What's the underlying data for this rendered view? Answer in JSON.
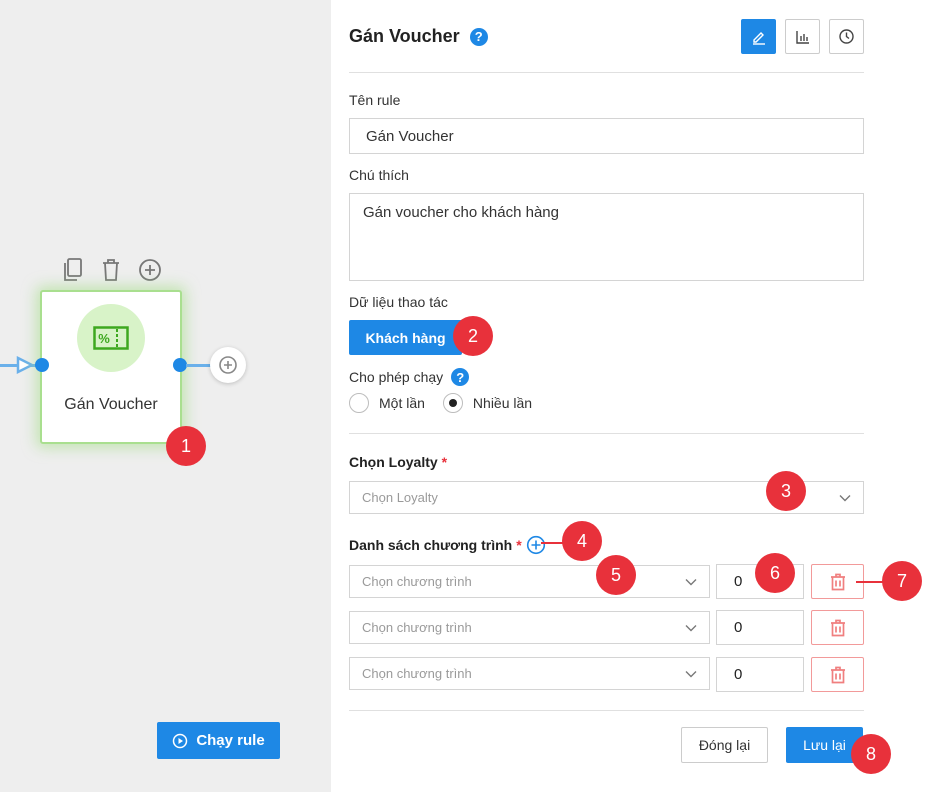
{
  "canvas": {
    "node_label": "Gán Voucher",
    "node_icon": "voucher-percent-icon",
    "tools": [
      "copy-icon",
      "trash-icon",
      "plus-circle-icon"
    ],
    "run_button": "Chạy rule"
  },
  "panel": {
    "title": "Gán Voucher",
    "help": "?",
    "toolbar": [
      "edit-icon",
      "chart-icon",
      "history-icon"
    ],
    "rule_name_label": "Tên rule",
    "rule_name_value": "Gán Voucher",
    "note_label": "Chú thích",
    "note_value": "Gán voucher cho khách hàng",
    "data_label": "Dữ liệu thao tác",
    "data_button": "Khách hàng",
    "allow_run_label": "Cho phép chạy",
    "allow_run_options": [
      "Một lần",
      "Nhiều lần"
    ],
    "allow_run_selected": "Nhiều lần",
    "loyalty_label": "Chọn Loyalty",
    "loyalty_placeholder": "Chọn Loyalty",
    "programs_label": "Danh sách chương trình",
    "required_mark": "*",
    "program_rows": [
      {
        "placeholder": "Chọn chương trình",
        "quantity": "0"
      },
      {
        "placeholder": "Chọn chương trình",
        "quantity": "0"
      },
      {
        "placeholder": "Chọn chương trình",
        "quantity": "0"
      }
    ],
    "close_button": "Đóng lại",
    "save_button": "Lưu lại"
  },
  "callouts": [
    "1",
    "2",
    "3",
    "4",
    "5",
    "6",
    "7",
    "8"
  ],
  "colors": {
    "primary": "#1e88e5",
    "callout": "#e8313b",
    "node_glow": "#a9df8f",
    "danger": "#f29a9a"
  }
}
